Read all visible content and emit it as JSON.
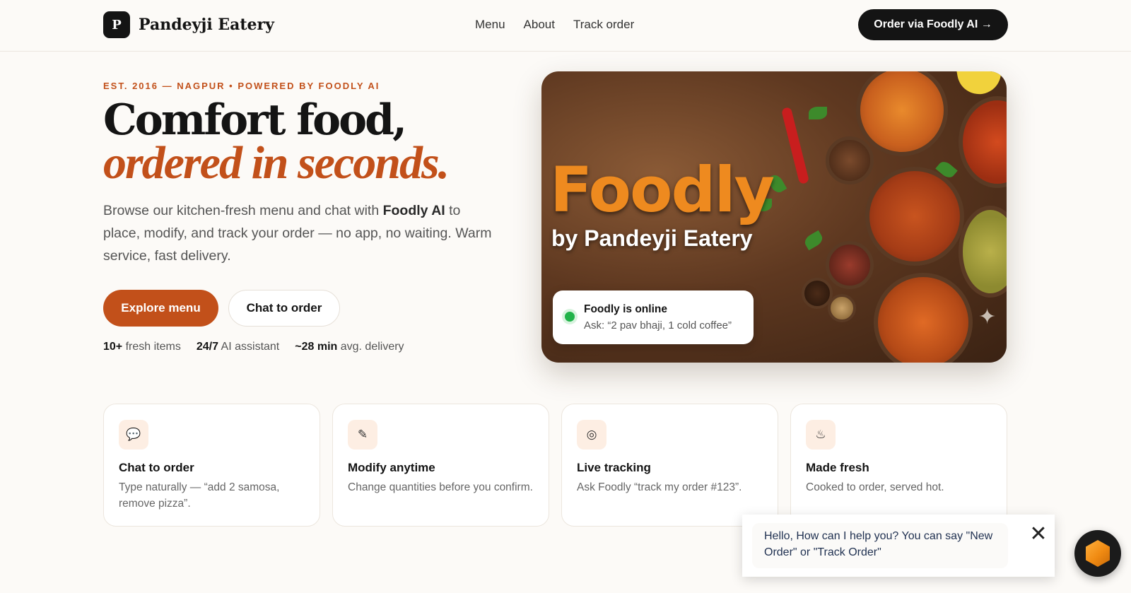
{
  "header": {
    "logo_letter": "P",
    "brand": "Pandeyji Eatery",
    "nav": [
      "Menu",
      "About",
      "Track order"
    ],
    "cta": "Order via Foodly AI →"
  },
  "hero": {
    "eyebrow": "EST. 2016 — NAGPUR • POWERED BY FOODLY AI",
    "headline_1": "Comfort food,",
    "headline_2": "ordered in seconds.",
    "lead_1": "Browse our kitchen-fresh menu and chat with ",
    "lead_strong": "Foodly AI",
    "lead_2": " to place, modify, and track your order — no app, no waiting. Warm service, fast delivery.",
    "primary_button": "Explore menu",
    "secondary_button": "Chat to order",
    "stats": [
      {
        "value": "10+",
        "label": "fresh items"
      },
      {
        "value": "24/7",
        "label": "AI assistant"
      },
      {
        "value": "~28 min",
        "label": "avg. delivery"
      }
    ],
    "image": {
      "brand": "Foodly",
      "brand_sub": "by Pandeyji Eatery",
      "status_title": "Foodly is online",
      "status_ask": "Ask: “2 pav bhaji, 1 cold coffee”"
    }
  },
  "features": [
    {
      "icon": "speech-bubble-icon",
      "glyph": "💬",
      "title": "Chat to order",
      "desc": "Type naturally — “add 2 samosa, remove pizza”."
    },
    {
      "icon": "pencil-icon",
      "glyph": "✎",
      "title": "Modify anytime",
      "desc": "Change quantities before you confirm."
    },
    {
      "icon": "target-icon",
      "glyph": "◎",
      "title": "Live tracking",
      "desc": "Ask Foodly “track my order #123”."
    },
    {
      "icon": "hot-food-icon",
      "glyph": "♨",
      "title": "Made fresh",
      "desc": "Cooked to order, served hot."
    }
  ],
  "chat_widget": {
    "message": "Hello, How can I help you? You can say \"New Order\" or \"Track Order\"",
    "close_glyph": "✕"
  },
  "colors": {
    "accent": "#c2501a",
    "dark": "#141414",
    "online": "#22b34a",
    "brand_orange": "#ee8a1f"
  }
}
